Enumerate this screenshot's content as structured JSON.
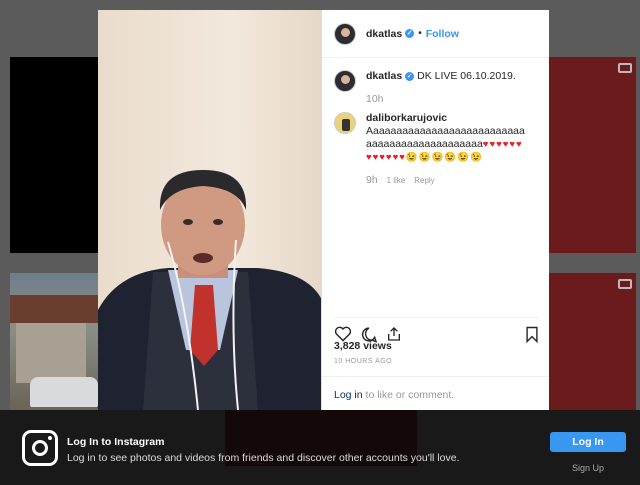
{
  "post": {
    "username": "dkatlas",
    "follow_label": "Follow",
    "dot": "•",
    "caption": "DK LIVE 06.10.2019.",
    "caption_age": "10h",
    "comment": {
      "username": "daliborkarujovic",
      "text": "Aaaaaaaaaaaaaaaaaaaaaaaaaaaaaaaaaaaaaaaaaaaaaaa",
      "hearts": "♥♥♥♥♥♥♥♥♥♥♥♥",
      "winks": "😉😉😉😉😉😉",
      "age": "9h",
      "likes": "1 like",
      "reply_label": "Reply"
    },
    "views": "3,828 views",
    "posted_ago": "10 HOURS AGO",
    "login_link": "Log in",
    "login_rest": " to like or comment."
  },
  "banner": {
    "title": "Log In to Instagram",
    "subtitle": "Log in to see photos and videos from friends and discover other accounts you'll love.",
    "login_button": "Log In",
    "signup_hint": "Sign Up"
  },
  "icons": [
    "heart-icon",
    "comment-icon",
    "share-icon",
    "bookmark-icon",
    "verified-icon",
    "instagram-icon",
    "video-icon"
  ],
  "colors": {
    "accent": "#3897f0",
    "heart": "#ed1c24"
  }
}
